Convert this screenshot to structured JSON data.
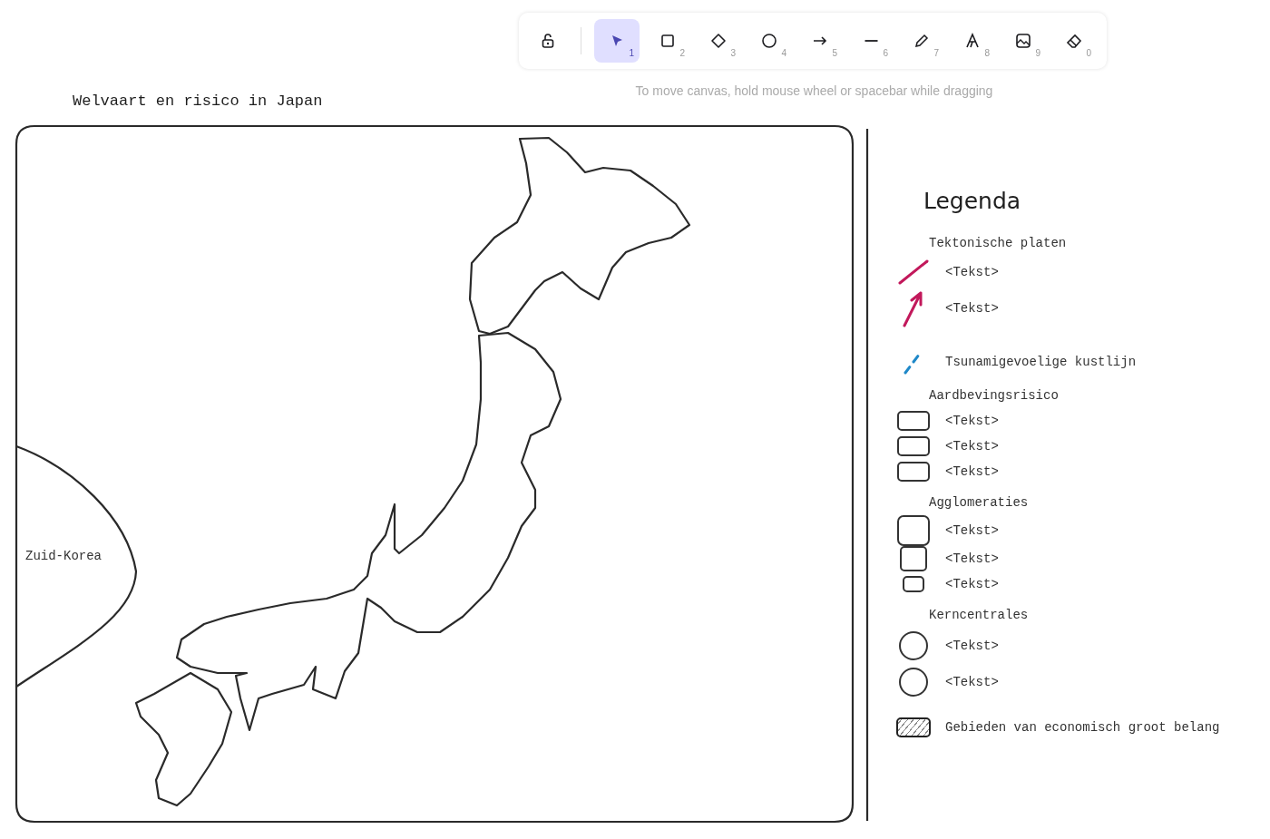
{
  "toolbar": {
    "lock": {
      "locked": false
    },
    "tools": [
      {
        "kind": "select",
        "shortcut": "1",
        "selected": true
      },
      {
        "kind": "rectangle",
        "shortcut": "2",
        "selected": false
      },
      {
        "kind": "diamond",
        "shortcut": "3",
        "selected": false
      },
      {
        "kind": "ellipse",
        "shortcut": "4",
        "selected": false
      },
      {
        "kind": "arrow",
        "shortcut": "5",
        "selected": false
      },
      {
        "kind": "line",
        "shortcut": "6",
        "selected": false
      },
      {
        "kind": "draw",
        "shortcut": "7",
        "selected": false
      },
      {
        "kind": "text",
        "shortcut": "8",
        "selected": false
      },
      {
        "kind": "image",
        "shortcut": "9",
        "selected": false
      },
      {
        "kind": "eraser",
        "shortcut": "0",
        "selected": false
      }
    ],
    "hint": "To move canvas, hold mouse wheel or spacebar while dragging"
  },
  "canvas": {
    "title": "Welvaart en risico in Japan",
    "map": {
      "labels": [
        "Zuid-Korea"
      ]
    },
    "legend": {
      "title": "Legenda",
      "items": [
        {
          "kind": "heading",
          "text": "Tektonische platen"
        },
        {
          "kind": "line",
          "text": "<Tekst>",
          "color": "#c2185b"
        },
        {
          "kind": "arrow",
          "text": "<Tekst>",
          "color": "#c2185b"
        },
        {
          "kind": "dashed",
          "text": "Tsunamigevoelige kustlijn",
          "color": "#1e88c8"
        },
        {
          "kind": "heading",
          "text": "Aardbevingsrisico"
        },
        {
          "kind": "box-wide",
          "text": "<Tekst>"
        },
        {
          "kind": "box-wide",
          "text": "<Tekst>"
        },
        {
          "kind": "box-wide",
          "text": "<Tekst>"
        },
        {
          "kind": "heading",
          "text": "Agglomeraties"
        },
        {
          "kind": "box-large",
          "text": "<Tekst>"
        },
        {
          "kind": "box-medium",
          "text": "<Tekst>"
        },
        {
          "kind": "box-small",
          "text": "<Tekst>"
        },
        {
          "kind": "heading",
          "text": "Kerncentrales"
        },
        {
          "kind": "circle",
          "text": "<Tekst>"
        },
        {
          "kind": "circle",
          "text": "<Tekst>"
        },
        {
          "kind": "hatched",
          "text": "Gebieden van economisch groot belang"
        }
      ]
    }
  }
}
